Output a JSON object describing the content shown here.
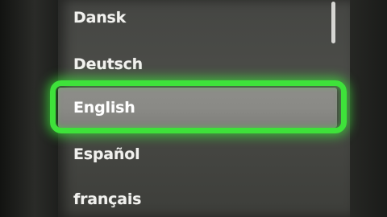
{
  "language_list": {
    "items": [
      {
        "label": "Dansk"
      },
      {
        "label": "Deutsch"
      },
      {
        "label": "English"
      },
      {
        "label": "Español"
      },
      {
        "label": "français"
      }
    ],
    "selected_index": 2
  },
  "colors": {
    "focus_ring": "#3ee23a",
    "panel_bg": "#474844",
    "selected_bg": "#8a8a86",
    "text": "#f1f1ee"
  }
}
